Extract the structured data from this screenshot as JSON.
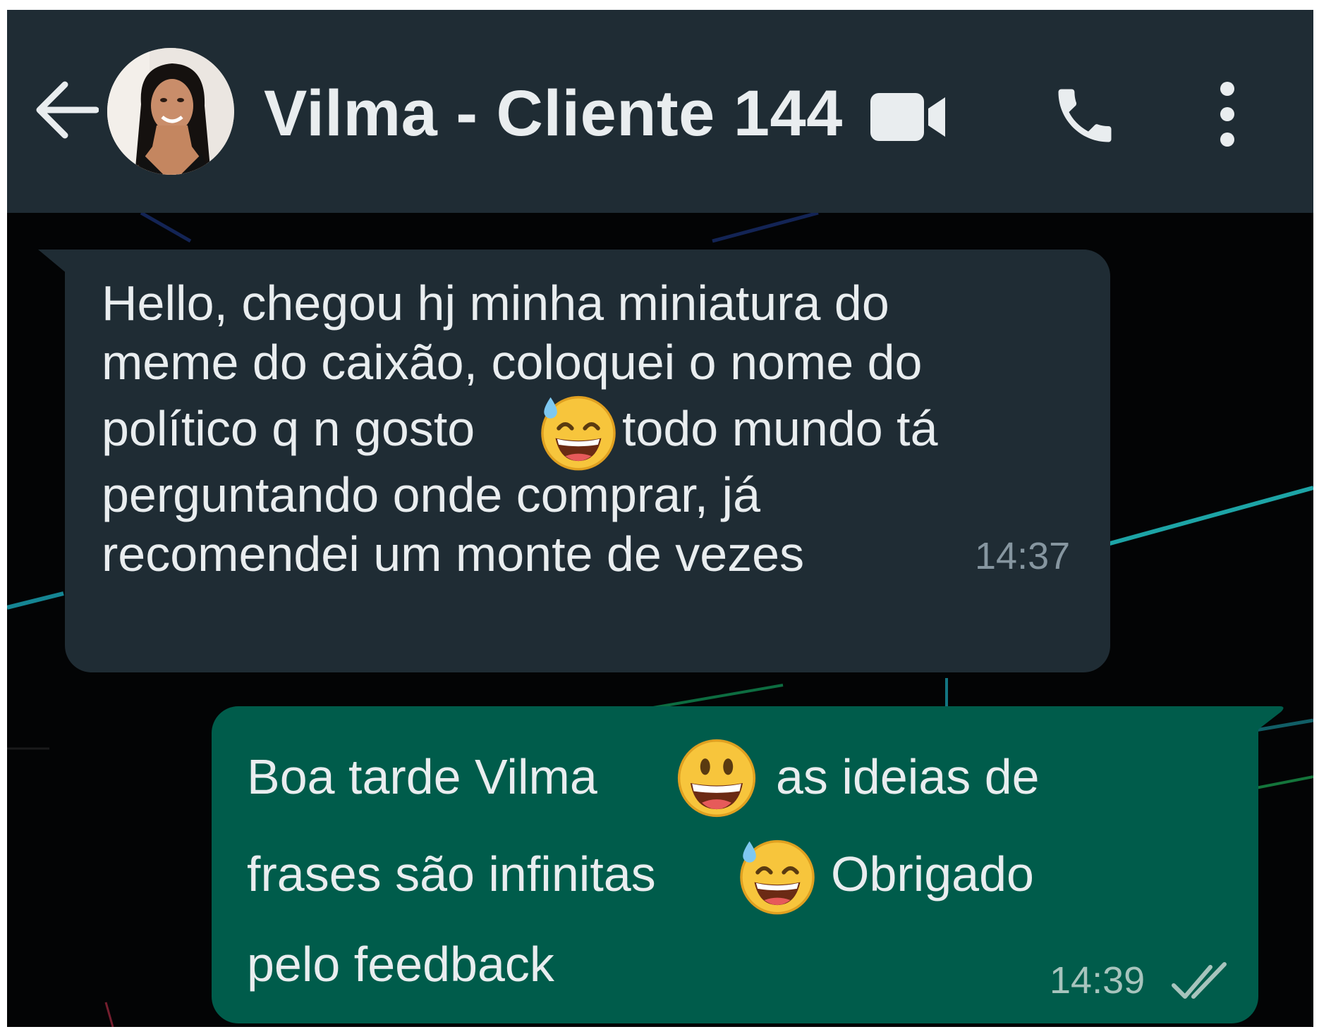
{
  "header": {
    "contact_name": "Vilma - Cliente 144",
    "background": "#1f2c34",
    "icons": [
      "back-arrow-icon",
      "video-camera-icon",
      "phone-icon",
      "more-vertical-icon"
    ]
  },
  "messages": [
    {
      "direction": "incoming",
      "lines": [
        "Hello, chegou hj minha miniatura do",
        "meme do caixão, coloquei o nome do",
        "político q n gosto",
        "todo mundo tá",
        "perguntando onde comprar, já",
        "recomendei um monte de vezes"
      ],
      "emoji": "grinning-sweat-emoji",
      "time": "14:37",
      "bubble_color": "#1f2c34"
    },
    {
      "direction": "outgoing",
      "lines": [
        "Boa tarde Vilma",
        "as ideias de",
        "frases são infinitas",
        "Obrigado",
        "pelo feedback"
      ],
      "emojis": [
        "grinning-emoji",
        "grinning-sweat-emoji"
      ],
      "time": "14:39",
      "status": "delivered-double-check",
      "bubble_color": "#005c4b"
    }
  ]
}
